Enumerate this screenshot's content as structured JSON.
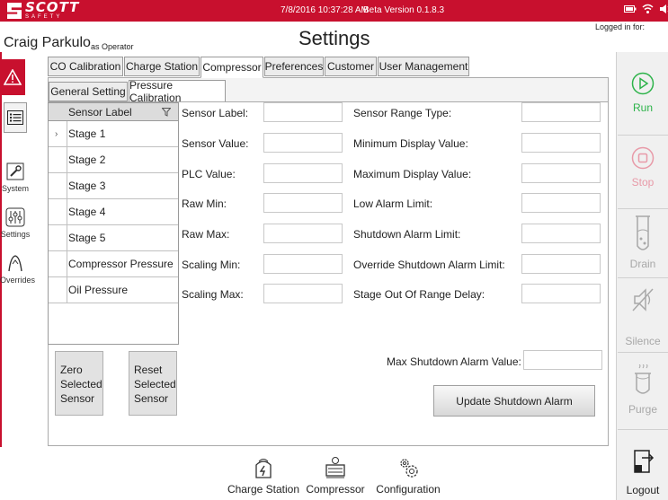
{
  "topbar": {
    "logo_text": "SCOTT",
    "logo_sub": "SAFETY",
    "datetime": "7/8/2016 10:37:28 AM",
    "version": "Beta Version 0.1.8.3",
    "status_icons": [
      "battery-icon",
      "wifi-icon",
      "volume-icon"
    ]
  },
  "header": {
    "user_name": "Craig Parkulo",
    "user_role": "as Operator",
    "title": "Settings",
    "logged_in_label": "Logged in for:"
  },
  "left_nav": {
    "items": [
      {
        "label": "System",
        "icon": "wrench-icon"
      },
      {
        "label": "Settings",
        "icon": "sliders-icon"
      },
      {
        "label": "Overrides",
        "icon": "override-icon"
      }
    ]
  },
  "tabs": {
    "main": [
      "CO Calibration",
      "Charge Station",
      "Compressor",
      "Preferences",
      "Customer",
      "User Management"
    ],
    "active_main": "Compressor",
    "sub": [
      "General Setting",
      "Pressure Calibration"
    ],
    "active_sub": "Pressure Calibration"
  },
  "sensor_list": {
    "header": "Sensor Label",
    "selected_index": 0,
    "rows": [
      "Stage 1",
      "Stage 2",
      "Stage 3",
      "Stage 4",
      "Stage 5",
      "Compressor Pressure",
      "Oil Pressure"
    ]
  },
  "form": {
    "left_labels": [
      "Sensor Label:",
      "Sensor Value:",
      "PLC Value:",
      "Raw Min:",
      "Raw Max:",
      "Scaling Min:",
      "Scaling Max:"
    ],
    "right_labels": [
      "Sensor Range Type:",
      "Minimum Display Value:",
      "Maximum Display Value:",
      "Low Alarm Limit:",
      "Shutdown Alarm Limit:",
      "Override Shutdown Alarm Limit:",
      "Stage Out Of Range Delay:"
    ],
    "max_shutdown_label": "Max Shutdown Alarm Value:"
  },
  "buttons": {
    "zero_lines": [
      "Zero",
      "Selected",
      "Sensor"
    ],
    "reset_lines": [
      "Reset",
      "Selected",
      "Sensor"
    ],
    "update_shutdown": "Update Shutdown Alarm"
  },
  "bottom_nav": {
    "items": [
      "Charge Station",
      "Compressor",
      "Configuration"
    ]
  },
  "right_panel": {
    "run": "Run",
    "stop": "Stop",
    "drain": "Drain",
    "silence": "Silence",
    "purge": "Purge",
    "logout": "Logout"
  },
  "colors": {
    "brand_red": "#c8102e",
    "run_green": "#2db34a",
    "stop_pink": "#e89aa8",
    "disabled_gray": "#a8a8a8"
  }
}
